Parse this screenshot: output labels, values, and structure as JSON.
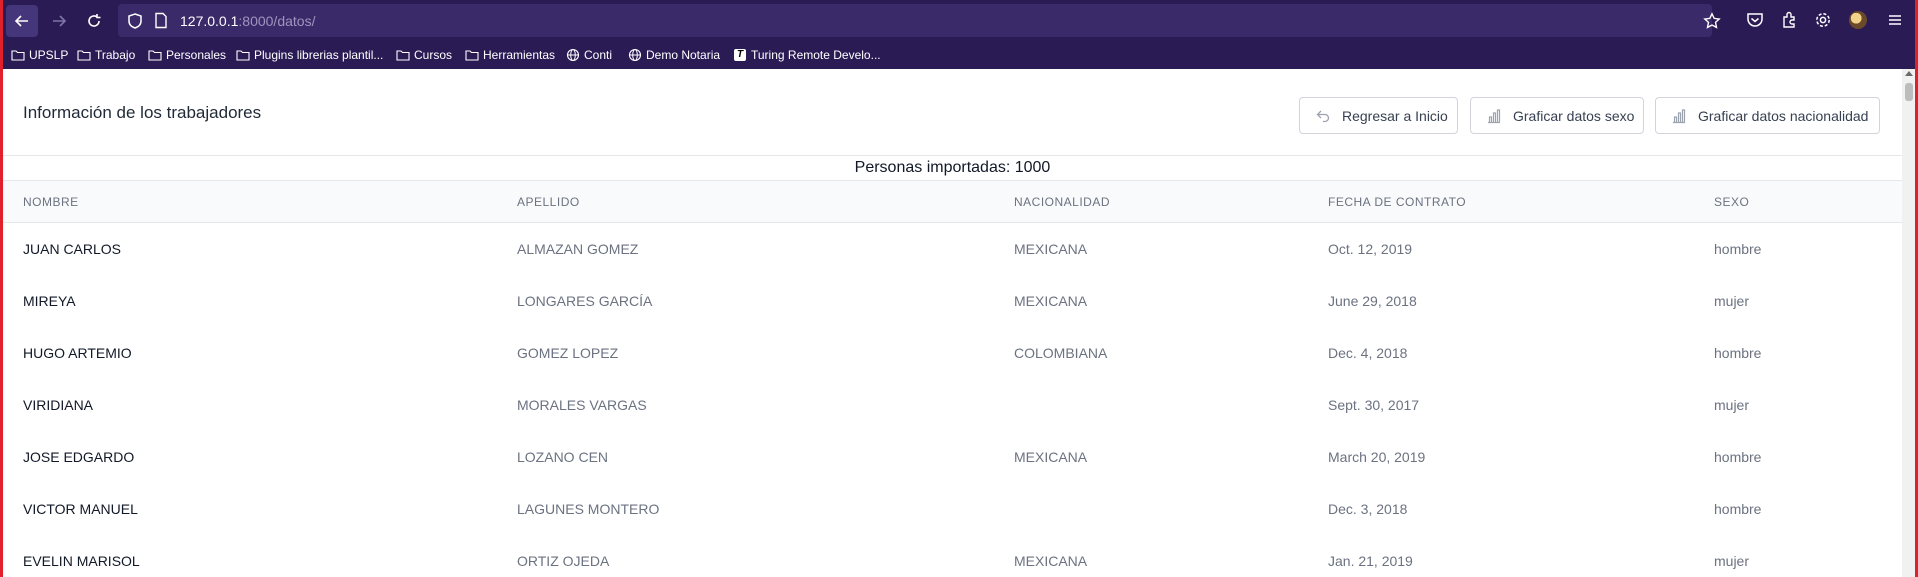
{
  "browser": {
    "url_host": "127.0.0.1",
    "url_path": ":8000/datos/",
    "bookmarks": [
      {
        "label": "UPSLP",
        "icon": "folder-icon"
      },
      {
        "label": "Trabajo",
        "icon": "folder-icon"
      },
      {
        "label": "Personales",
        "icon": "folder-icon"
      },
      {
        "label": "Plugins librerias plantil...",
        "icon": "folder-icon"
      },
      {
        "label": "Cursos",
        "icon": "folder-icon"
      },
      {
        "label": "Herramientas",
        "icon": "folder-icon"
      },
      {
        "label": "Conti",
        "icon": "globe-icon"
      },
      {
        "label": "Demo Notaria",
        "icon": "globe-icon"
      },
      {
        "label": "Turing Remote Develo...",
        "icon": "turing-icon"
      }
    ]
  },
  "header": {
    "title": "Información de los trabajadores",
    "buttons": {
      "inicio": "Regresar a Inicio",
      "sexo": "Graficar datos sexo",
      "nacionalidad": "Graficar datos nacionalidad"
    }
  },
  "summary": "Personas importadas: 1000",
  "table": {
    "columns": [
      "NOMBRE",
      "APELLIDO",
      "NACIONALIDAD",
      "FECHA DE CONTRATO",
      "SEXO"
    ],
    "rows": [
      [
        "JUAN CARLOS",
        "ALMAZAN GOMEZ",
        "MEXICANA",
        "Oct. 12, 2019",
        "hombre"
      ],
      [
        "MIREYA",
        "LONGARES GARCÍA",
        "MEXICANA",
        "June 29, 2018",
        "mujer"
      ],
      [
        "HUGO ARTEMIO",
        "GOMEZ LOPEZ",
        "COLOMBIANA",
        "Dec. 4, 2018",
        "hombre"
      ],
      [
        "VIRIDIANA",
        "MORALES VARGAS",
        "",
        "Sept. 30, 2017",
        "mujer"
      ],
      [
        "JOSE EDGARDO",
        "LOZANO CEN",
        "MEXICANA",
        "March 20, 2019",
        "hombre"
      ],
      [
        "VICTOR MANUEL",
        "LAGUNES MONTERO",
        "",
        "Dec. 3, 2018",
        "hombre"
      ],
      [
        "EVELIN MARISOL",
        "ORTIZ OJEDA",
        "MEXICANA",
        "Jan. 21, 2019",
        "mujer"
      ]
    ]
  },
  "colors": {
    "chrome": "#2b1b55",
    "frame": "#e0202a"
  }
}
